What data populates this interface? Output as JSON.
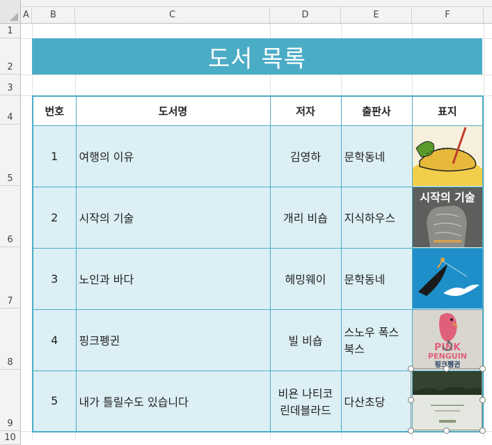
{
  "columns": [
    "A",
    "B",
    "C",
    "D",
    "E",
    "F"
  ],
  "rows": [
    "1",
    "2",
    "3",
    "4",
    "5",
    "6",
    "7",
    "8",
    "9",
    "10"
  ],
  "title": "도서 목록",
  "table": {
    "headers": {
      "num": "번호",
      "title": "도서명",
      "author": "저자",
      "publisher": "출판사",
      "cover": "표지"
    },
    "rows": [
      {
        "num": "1",
        "title": "여행의 이유",
        "author": "김영하",
        "publisher": "문학동네",
        "cover": "cover-art-travel"
      },
      {
        "num": "2",
        "title": "시작의 기술",
        "author": "개리 비숍",
        "publisher": "지식하우스",
        "cover": "cover-art-start"
      },
      {
        "num": "3",
        "title": "노인과 바다",
        "author": "헤밍웨이",
        "publisher": "문학동네",
        "cover": "cover-art-sea"
      },
      {
        "num": "4",
        "title": "핑크펭귄",
        "author": "빌 비숍",
        "publisher": "스노우 폭스\n북스",
        "cover": "cover-art-penguin"
      },
      {
        "num": "5",
        "title": "내가 틀릴수도 있습니다",
        "author": "비욘 나티코\n린데블라드",
        "publisher": "다산초당",
        "cover": "cover-art-wrong"
      }
    ]
  },
  "cover_text": {
    "start": "시작의 기술",
    "penguin_top": "PINK",
    "penguin_mid": "PENGUIN",
    "penguin_ko": "핑크펭귄"
  },
  "colors": {
    "accent": "#4bacc6",
    "row_fill": "#dbeff5"
  }
}
